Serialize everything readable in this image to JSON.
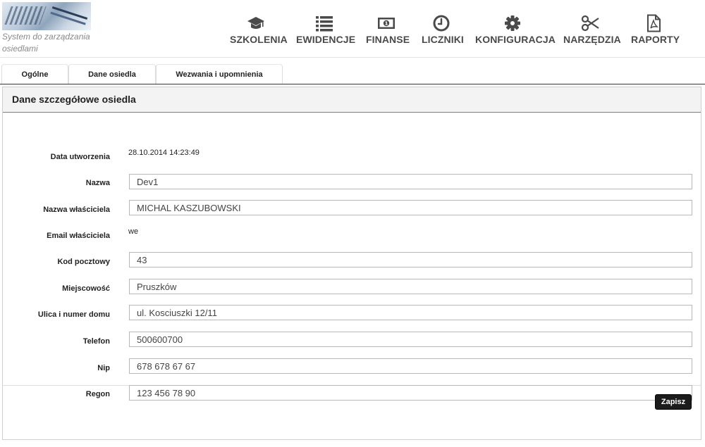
{
  "app": {
    "tagline": "System do zarządzania osiedlami"
  },
  "nav": [
    {
      "label": "SZKOLENIA",
      "icon": "graduation-cap-icon"
    },
    {
      "label": "EWIDENCJE",
      "icon": "list-icon"
    },
    {
      "label": "FINANSE",
      "icon": "money-icon"
    },
    {
      "label": "LICZNIKI",
      "icon": "clock-icon"
    },
    {
      "label": "KONFIGURACJA",
      "icon": "gear-icon"
    },
    {
      "label": "NARZĘDZIA",
      "icon": "scissors-icon"
    },
    {
      "label": "RAPORTY",
      "icon": "pdf-file-icon"
    }
  ],
  "tabs": [
    "Ogólne",
    "Dane osiedla",
    "Wezwania i upomnienia"
  ],
  "panel": {
    "title": "Dane szczegółowe osiedla",
    "fields": [
      {
        "label": "Data utworzenia",
        "value": "28.10.2014 14:23:49",
        "type": "text"
      },
      {
        "label": "Nazwa",
        "value": "Dev1",
        "type": "input"
      },
      {
        "label": "Nazwa właściciela",
        "value": "MICHAL KASZUBOWSKI",
        "type": "input"
      },
      {
        "label": "Email właściciela",
        "value": "we",
        "type": "text"
      },
      {
        "label": "Kod pocztowy",
        "value": "43",
        "type": "input"
      },
      {
        "label": "Miejscowość",
        "value": "Pruszków",
        "type": "input"
      },
      {
        "label": "Ulica i numer domu",
        "value": "ul. Kosciuszki 12/11",
        "type": "input"
      },
      {
        "label": "Telefon",
        "value": "500600700",
        "type": "input"
      },
      {
        "label": "Nip",
        "value": "678 678 67 67",
        "type": "input"
      },
      {
        "label": "Regon",
        "value": "123 456 78 90",
        "type": "input"
      }
    ],
    "save_label": "Zapisz"
  }
}
